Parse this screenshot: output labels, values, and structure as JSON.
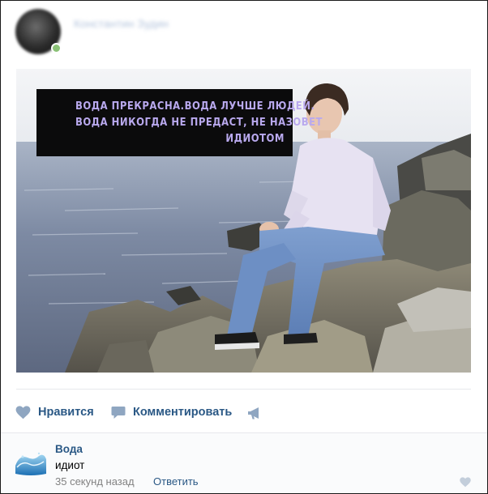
{
  "post": {
    "author_name": "Константин Зудин",
    "caption_lines": [
      "ВОДА ПРЕКРАСНА.ВОДА ЛУЧШЕ ЛЮДЕЙ.",
      "ВОДА НИКОГДА НЕ ПРЕДАСТ, НЕ НАЗОВЕТ",
      "ИДИОТОМ"
    ]
  },
  "actions": {
    "like_label": "Нравится",
    "comment_label": "Комментировать",
    "like_icon": "heart-icon",
    "comment_icon": "speech-bubble-icon",
    "share_icon": "megaphone-icon"
  },
  "comment": {
    "author": "Вода",
    "text": "идиот",
    "time": "35 секунд назад",
    "reply_label": "Ответить",
    "like_icon": "heart-icon"
  },
  "colors": {
    "link": "#2a5885",
    "caption_text": "#b9a9ee",
    "caption_bg": "#0b0b0c",
    "online": "#8ac176"
  }
}
